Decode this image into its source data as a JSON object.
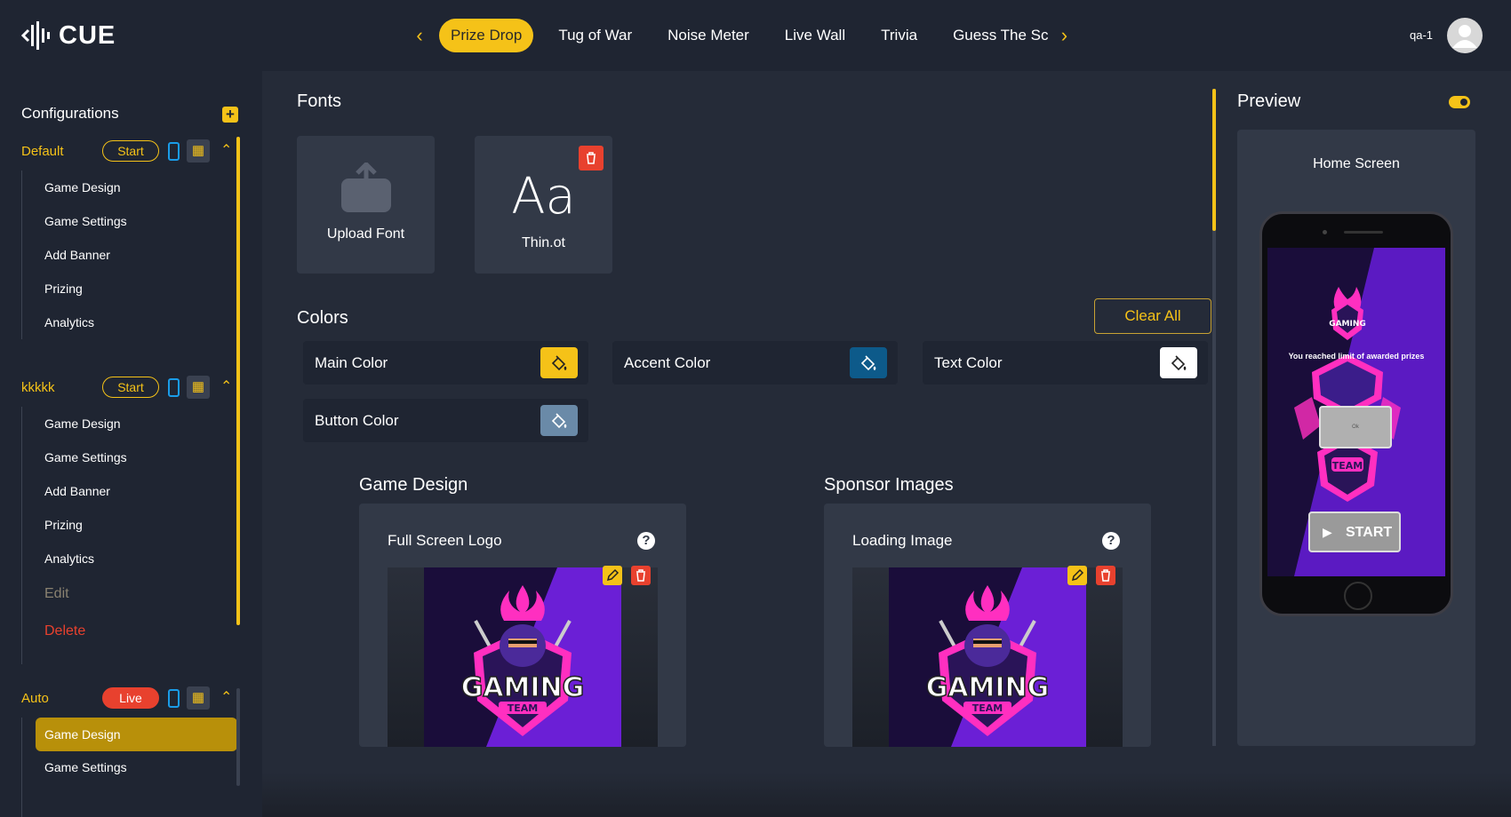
{
  "app": {
    "name": "CUE"
  },
  "nav": {
    "tabs": [
      "Prize Drop",
      "Tug of War",
      "Noise Meter",
      "Live Wall",
      "Trivia",
      "Guess The Sc"
    ],
    "active_tab": "Prize Drop"
  },
  "user": {
    "name": "qa-1"
  },
  "sidebar": {
    "title": "Configurations",
    "groups": [
      {
        "name": "Default",
        "status": "Start",
        "items": [
          "Game Design",
          "Game Settings",
          "Add Banner",
          "Prizing",
          "Analytics"
        ]
      },
      {
        "name": "kkkkk",
        "status": "Start",
        "items": [
          "Game Design",
          "Game Settings",
          "Add Banner",
          "Prizing",
          "Analytics",
          "Edit",
          "Delete"
        ]
      },
      {
        "name": "Auto",
        "status": "Live",
        "items": [
          "Game Design",
          "Game Settings"
        ],
        "active_item": "Game Design"
      }
    ]
  },
  "fonts": {
    "title": "Fonts",
    "upload_label": "Upload Font",
    "font_sample": "Aa",
    "font_name": "Thin.ot"
  },
  "colors": {
    "title": "Colors",
    "clear_all": "Clear All",
    "items": [
      {
        "label": "Main Color",
        "value": "#f5c218"
      },
      {
        "label": "Accent Color",
        "value": "#0d5a8a"
      },
      {
        "label": "Text Color",
        "value": "#ffffff"
      },
      {
        "label": "Button Color",
        "value": "#6a8aa8"
      }
    ]
  },
  "game_design": {
    "title": "Game Design",
    "card_title": "Full Screen Logo"
  },
  "sponsor_images": {
    "title": "Sponsor Images",
    "card_title": "Loading Image"
  },
  "preview": {
    "title": "Preview",
    "screen_label": "Home Screen",
    "logo_text": "GAMING",
    "logo_subtext": "TEAM",
    "limit_message": "You reached limit of awarded prizes",
    "ok_label": "Ok",
    "start_label": "START"
  },
  "art": {
    "logo_text": "GAMING",
    "logo_subtext": "TEAM"
  }
}
